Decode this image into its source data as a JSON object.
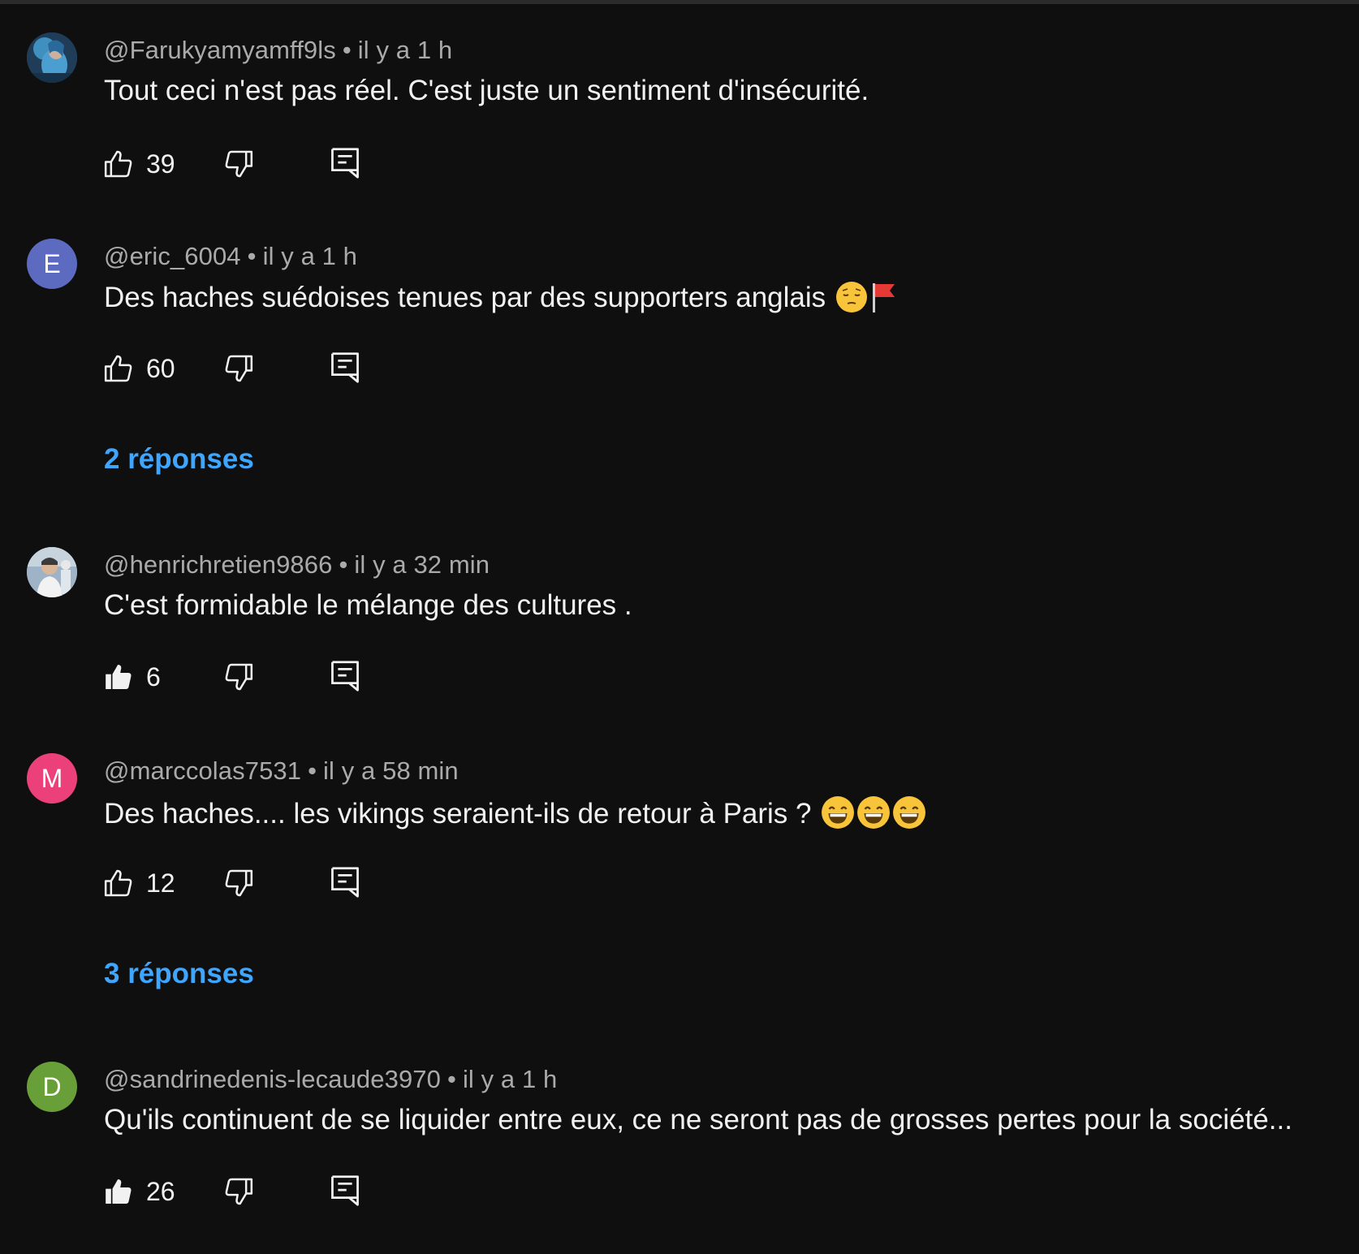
{
  "comments": [
    {
      "author": "@Farukyamyamff9ls",
      "time": "il y a 1 h",
      "text": "Tout ceci n'est pas réel. C'est juste un sentiment d'insécurité.",
      "emojis": [],
      "likes": "39",
      "liked": false,
      "avatar": {
        "type": "photo",
        "letter": "",
        "color": "#2b4e6e"
      },
      "replies": ""
    },
    {
      "author": "@eric_6004",
      "time": "il y a 1 h",
      "text": "Des haches suédoises tenues par des supporters anglais ",
      "emojis": [
        "pensive-face",
        "red-flag"
      ],
      "likes": "60",
      "liked": false,
      "avatar": {
        "type": "letter",
        "letter": "E",
        "color": "#5c6bc0"
      },
      "replies": "2 réponses"
    },
    {
      "author": "@henrichretien9866",
      "time": "il y a 32 min",
      "text": "C'est formidable le mélange des cultures .",
      "emojis": [],
      "likes": "6",
      "liked": true,
      "avatar": {
        "type": "photo",
        "letter": "",
        "color": "#8fa3b8"
      },
      "replies": ""
    },
    {
      "author": "@marccolas7531",
      "time": "il y a 58 min",
      "text": "Des haches.... les vikings seraient-ils de retour à Paris ? ",
      "emojis": [
        "grinning-face",
        "grinning-face",
        "grinning-face"
      ],
      "likes": "12",
      "liked": false,
      "avatar": {
        "type": "letter",
        "letter": "M",
        "color": "#ec407a"
      },
      "replies": "3 réponses"
    },
    {
      "author": "@sandrinedenis-lecaude3970",
      "time": "il y a 1 h",
      "text": "Qu'ils continuent de se liquider entre eux, ce ne seront pas de grosses pertes pour la société...",
      "emojis": [],
      "likes": "26",
      "liked": true,
      "avatar": {
        "type": "letter",
        "letter": "D",
        "color": "#689f38"
      },
      "replies": ""
    }
  ],
  "separator": "•"
}
